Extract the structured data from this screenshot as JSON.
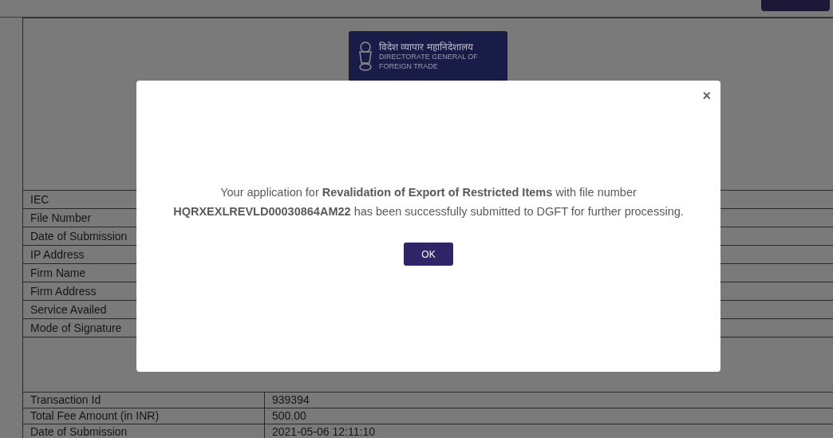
{
  "header": {
    "logo": {
      "hindi": "विदेश व्यापार महानिदेशालय",
      "english_lines": [
        "DIRECTORATE GENERAL OF",
        "FOREIGN TRADE"
      ]
    }
  },
  "details_table": {
    "rows": [
      {
        "label": "IEC"
      },
      {
        "label": "File Number"
      },
      {
        "label": "Date of Submission"
      },
      {
        "label": "IP Address"
      },
      {
        "label": "Firm Name"
      },
      {
        "label": "Firm Address"
      },
      {
        "label": "Service Availed"
      },
      {
        "label": "Mode of Signature"
      }
    ]
  },
  "payment_table": {
    "rows": [
      {
        "label": "Transaction Id",
        "value": "939394"
      },
      {
        "label": "Total Fee Amount (in INR)",
        "value": "500.00"
      },
      {
        "label": "Date of Submission",
        "value": "2021-05-06 12:11:10"
      }
    ]
  },
  "dialog": {
    "close": "×",
    "message": "Your application for **Revalidation of Export of Restricted Items** with file number **HQRXEXLREVLD00030864AM22** has been successfully submitted to DGFT for further processing.",
    "ok_button": "OK"
  }
}
